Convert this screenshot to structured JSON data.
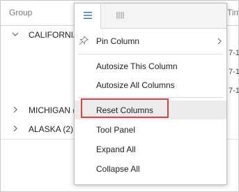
{
  "grid": {
    "header": {
      "group": "Group",
      "time": "Tim"
    },
    "rows": [
      {
        "label": "CALIFORNIA",
        "expanded": true,
        "cell": ""
      },
      {
        "label": "",
        "cell": "7-1"
      },
      {
        "label": "",
        "cell": "7-1"
      },
      {
        "label": "",
        "cell": "7-1"
      },
      {
        "label": "MICHIGAN (",
        "expanded": false,
        "cell": ""
      },
      {
        "label": "ALASKA (2)",
        "expanded": false,
        "cell": ""
      }
    ]
  },
  "menu": {
    "tabs": [
      {
        "icon": "menu-lines-icon",
        "active": true
      },
      {
        "icon": "columns-icon",
        "active": false
      }
    ],
    "items": [
      {
        "label": "Pin Column",
        "icon": "pin-icon",
        "submenu": true
      },
      {
        "label": "Autosize This Column"
      },
      {
        "label": "Autosize All Columns"
      },
      {
        "label": "Reset Columns",
        "highlighted": true
      },
      {
        "label": "Tool Panel"
      },
      {
        "label": "Expand All"
      },
      {
        "label": "Collapse All"
      }
    ]
  },
  "colors": {
    "accent": "#2c6fcb",
    "highlight_border": "#e2403d",
    "hover_bg": "#ececec"
  }
}
